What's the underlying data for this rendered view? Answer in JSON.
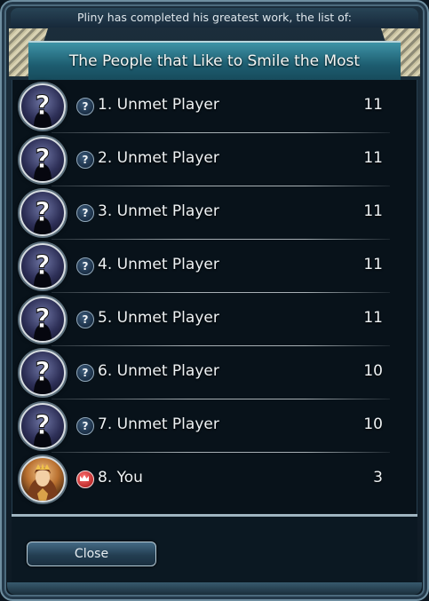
{
  "header": {
    "subtitle": "Pliny has completed his greatest work, the list of:",
    "title": "The People that Like to Smile the Most"
  },
  "players": [
    {
      "rank_name": "1. Unmet Player",
      "score": "11",
      "badge": "?",
      "avatar": "unknown-leader-icon"
    },
    {
      "rank_name": "2. Unmet Player",
      "score": "11",
      "badge": "?",
      "avatar": "unknown-leader-icon"
    },
    {
      "rank_name": "3. Unmet Player",
      "score": "11",
      "badge": "?",
      "avatar": "unknown-leader-icon"
    },
    {
      "rank_name": "4. Unmet Player",
      "score": "11",
      "badge": "?",
      "avatar": "unknown-leader-icon"
    },
    {
      "rank_name": "5. Unmet Player",
      "score": "11",
      "badge": "?",
      "avatar": "unknown-leader-icon"
    },
    {
      "rank_name": "6. Unmet Player",
      "score": "10",
      "badge": "?",
      "avatar": "unknown-leader-icon"
    },
    {
      "rank_name": "7. Unmet Player",
      "score": "10",
      "badge": "?",
      "avatar": "unknown-leader-icon"
    },
    {
      "rank_name": "8. You",
      "score": "3",
      "badge": "crown",
      "avatar": "leader-portrait-icon"
    }
  ],
  "footer": {
    "close_label": "Close"
  },
  "colors": {
    "title_bar": "#2a7a8e",
    "frame": "#6f8fa1",
    "list_background": "#08121a",
    "you_badge": "#c01818"
  }
}
